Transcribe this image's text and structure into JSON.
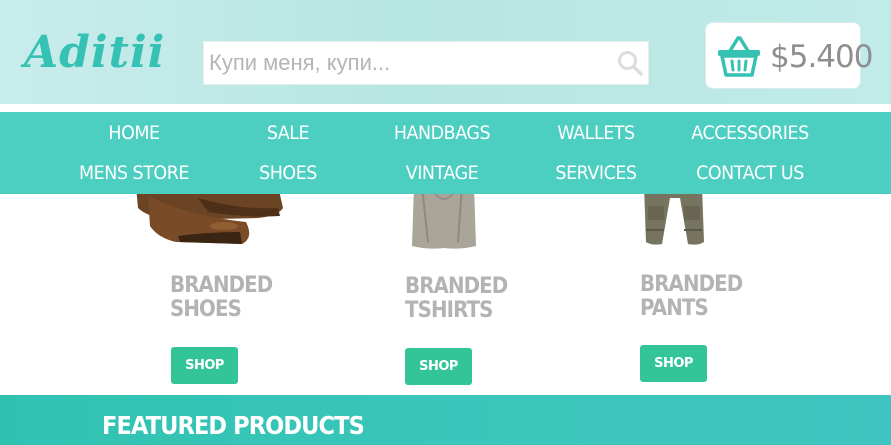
{
  "header": {
    "logo": "Aditii",
    "search": {
      "placeholder": "Купи меня, купи...",
      "value": ""
    },
    "cart": {
      "total": "$5.400"
    }
  },
  "nav": {
    "row1": [
      "HOME",
      "SALE",
      "HANDBAGS",
      "WALLETS",
      "ACCESSORIES"
    ],
    "row2": [
      "MENS STORE",
      "SHOES",
      "VINTAGE",
      "SERVICES",
      "CONTACT US"
    ]
  },
  "products": [
    {
      "title_line1": "BRANDED",
      "title_line2": "SHOES",
      "button": "SHOP"
    },
    {
      "title_line1": "BRANDED",
      "title_line2": "TSHIRTS",
      "button": "SHOP"
    },
    {
      "title_line1": "BRANDED",
      "title_line2": "PANTS",
      "button": "SHOP"
    }
  ],
  "featured": {
    "title": "FEATURED PRODUCTS"
  },
  "colors": {
    "accent": "#4ccfc1",
    "logo": "#35c1b4",
    "button": "#33c597",
    "header_bg": "#c0ebe8"
  },
  "icons": {
    "search": "search-icon",
    "cart": "basket-icon"
  }
}
